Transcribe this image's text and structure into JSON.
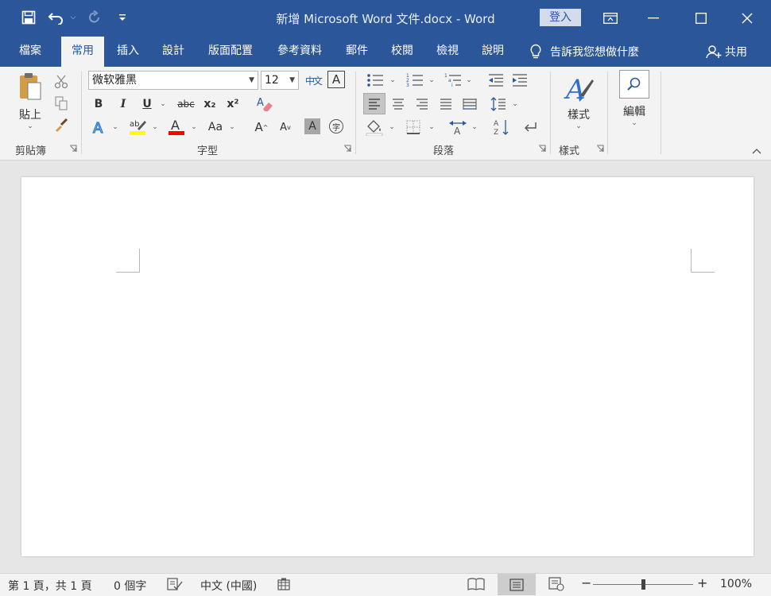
{
  "window": {
    "title": "新增 Microsoft Word 文件.docx  -  Word",
    "login_label": "登入"
  },
  "tabs": [
    {
      "label": "檔案"
    },
    {
      "label": "常用",
      "active": true
    },
    {
      "label": "插入"
    },
    {
      "label": "設計"
    },
    {
      "label": "版面配置"
    },
    {
      "label": "參考資料"
    },
    {
      "label": "郵件"
    },
    {
      "label": "校閱"
    },
    {
      "label": "檢視"
    },
    {
      "label": "說明"
    }
  ],
  "tellme": {
    "label": "告訴我您想做什麼"
  },
  "share": {
    "label": "共用"
  },
  "ribbon": {
    "clipboard": {
      "paste_label": "貼上",
      "group_label": "剪貼簿"
    },
    "font": {
      "font_name": "微软雅黑",
      "font_size": "12",
      "group_label": "字型",
      "bold": "B",
      "italic": "I",
      "underline": "U",
      "strike": "abc",
      "subscript": "x₂",
      "superscript": "x²",
      "change_case": "Aa",
      "grow": "A",
      "shrink": "A",
      "phonetic": "中文",
      "enclose": "字",
      "char_border": "A",
      "char_shading": "A"
    },
    "paragraph": {
      "group_label": "段落"
    },
    "styles": {
      "label": "樣式",
      "group_label": "樣式"
    },
    "editing": {
      "label": "編輯"
    }
  },
  "status": {
    "page": "第 1 頁，共 1 頁",
    "words": "0 個字",
    "language": "中文 (中國)",
    "zoom": "100%",
    "zoom_value": 0.5
  },
  "colors": {
    "brand": "#2b579a",
    "highlight": "#ffff00",
    "font_color": "#ff0000"
  }
}
